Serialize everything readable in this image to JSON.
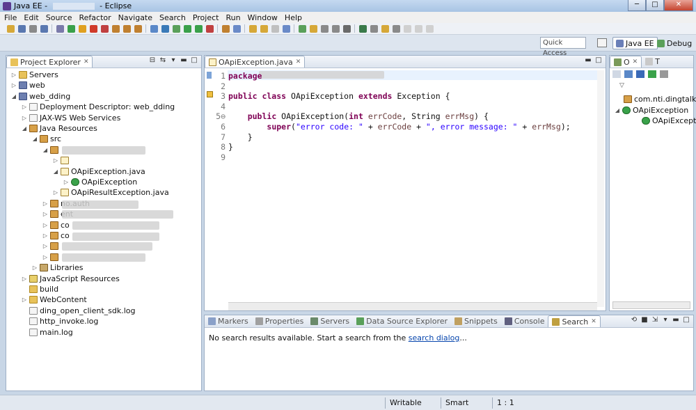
{
  "window": {
    "title_prefix": "Java EE - ",
    "title_suffix": " - Eclipse",
    "minimize": "─",
    "maximize": "□",
    "close": "✕"
  },
  "menu": [
    "File",
    "Edit",
    "Source",
    "Refactor",
    "Navigate",
    "Search",
    "Project",
    "Run",
    "Window",
    "Help"
  ],
  "perspective": {
    "quick_access": "Quick Access",
    "items": [
      {
        "label": "Java EE",
        "icon": "javaee-perspective-icon",
        "active": true
      },
      {
        "label": "Debug",
        "icon": "debug-perspective-icon",
        "active": false
      }
    ]
  },
  "project_explorer": {
    "title": "Project Explorer",
    "rows": [
      {
        "label": "Servers",
        "icon": "folder",
        "twisty": "▷",
        "indent": 0
      },
      {
        "label": "web",
        "icon": "proj",
        "twisty": "▷",
        "indent": 0
      },
      {
        "label": "web_dding",
        "icon": "proj",
        "twisty": "◢",
        "indent": 0
      },
      {
        "label": "Deployment Descriptor: web_dding",
        "icon": "file",
        "twisty": "▷",
        "indent": 1
      },
      {
        "label": "JAX-WS Web Services",
        "icon": "file",
        "twisty": "▷",
        "indent": 1
      },
      {
        "label": "Java Resources",
        "icon": "pkg",
        "twisty": "◢",
        "indent": 1
      },
      {
        "label": "src",
        "icon": "pkg",
        "twisty": "◢",
        "indent": 2
      },
      {
        "label": "",
        "icon": "pkg",
        "twisty": "◢",
        "indent": 3
      },
      {
        "label": "",
        "icon": "java",
        "twisty": "▷",
        "indent": 4
      },
      {
        "label": "OApiException.java",
        "icon": "java",
        "twisty": "◢",
        "indent": 4
      },
      {
        "label": "OApiException",
        "icon": "cls",
        "twisty": "▷",
        "indent": 5
      },
      {
        "label": "OApiResultException.java",
        "icon": "java",
        "twisty": "▷",
        "indent": 4
      },
      {
        "label": "no.auth",
        "icon": "pkg",
        "twisty": "▷",
        "indent": 3
      },
      {
        "label": "ent",
        "icon": "pkg",
        "twisty": "▷",
        "indent": 3
      },
      {
        "label": "co",
        "icon": "pkg",
        "twisty": "▷",
        "indent": 3
      },
      {
        "label": "co",
        "icon": "pkg",
        "twisty": "▷",
        "indent": 3
      },
      {
        "label": "",
        "icon": "pkg",
        "twisty": "▷",
        "indent": 3
      },
      {
        "label": "",
        "icon": "pkg",
        "twisty": "▷",
        "indent": 3
      },
      {
        "label": "Libraries",
        "icon": "lib",
        "twisty": "▷",
        "indent": 2
      },
      {
        "label": "JavaScript Resources",
        "icon": "js",
        "twisty": "▷",
        "indent": 1
      },
      {
        "label": "build",
        "icon": "folder",
        "twisty": "",
        "indent": 1
      },
      {
        "label": "WebContent",
        "icon": "folder",
        "twisty": "▷",
        "indent": 1
      },
      {
        "label": "ding_open_client_sdk.log",
        "icon": "file",
        "twisty": "",
        "indent": 1
      },
      {
        "label": "http_invoke.log",
        "icon": "file",
        "twisty": "",
        "indent": 1
      },
      {
        "label": "main.log",
        "icon": "file",
        "twisty": "",
        "indent": 1
      }
    ]
  },
  "editor": {
    "tab": "OApiException.java",
    "lines": [
      {
        "n": "1",
        "html": "<span class='kw'>package</span>"
      },
      {
        "n": "2",
        "html": ""
      },
      {
        "n": "3",
        "html": "<span class='kw'>public class</span> OApiException <span class='kw'>extends</span> Exception {"
      },
      {
        "n": "4",
        "html": ""
      },
      {
        "n": "5⊖",
        "html": "    <span class='kw'>public</span> OApiException(<span class='kw'>int</span> <span class='var'>errCode</span>, String <span class='var'>errMsg</span>) {"
      },
      {
        "n": "6",
        "html": "        <span class='kw'>super</span>(<span class='str'>\"error code: \"</span> + <span class='var'>errCode</span> + <span class='str'>\", error message: \"</span> + <span class='var'>errMsg</span>);"
      },
      {
        "n": "7",
        "html": "    }"
      },
      {
        "n": "8",
        "html": "}"
      },
      {
        "n": "9",
        "html": ""
      }
    ]
  },
  "outline": {
    "tab1": "O",
    "tab2": "T",
    "rows": [
      {
        "label": "com.nti.dingtalk.c",
        "icon": "pkg",
        "twisty": ""
      },
      {
        "label": "OApiException",
        "icon": "cls",
        "twisty": "◢"
      },
      {
        "label": "OApiExceptio",
        "icon": "cls",
        "twisty": "",
        "prefix": "● ᶜ"
      }
    ]
  },
  "bottom": {
    "tabs": [
      {
        "label": "Markers",
        "icon": "markers-icon",
        "active": false
      },
      {
        "label": "Properties",
        "icon": "properties-icon",
        "active": false
      },
      {
        "label": "Servers",
        "icon": "servers-icon",
        "active": false
      },
      {
        "label": "Data Source Explorer",
        "icon": "datasource-icon",
        "active": false
      },
      {
        "label": "Snippets",
        "icon": "snippets-icon",
        "active": false
      },
      {
        "label": "Console",
        "icon": "console-icon",
        "active": false
      },
      {
        "label": "Search",
        "icon": "search-icon",
        "active": true
      }
    ],
    "message": "No search results available. Start a search from the ",
    "link": "search dialog",
    "ellipsis": "..."
  },
  "status": {
    "writable": "Writable",
    "insert_mode": "Smart Insert",
    "position": "1 : 1"
  },
  "watermark": {
    "main": "Bai du 经验",
    "url": "jingyan.baidu.com"
  },
  "colors": {
    "keyword": "#7f0055",
    "string": "#2a00ff",
    "variable": "#6a3e3e",
    "link": "#0645ad"
  }
}
